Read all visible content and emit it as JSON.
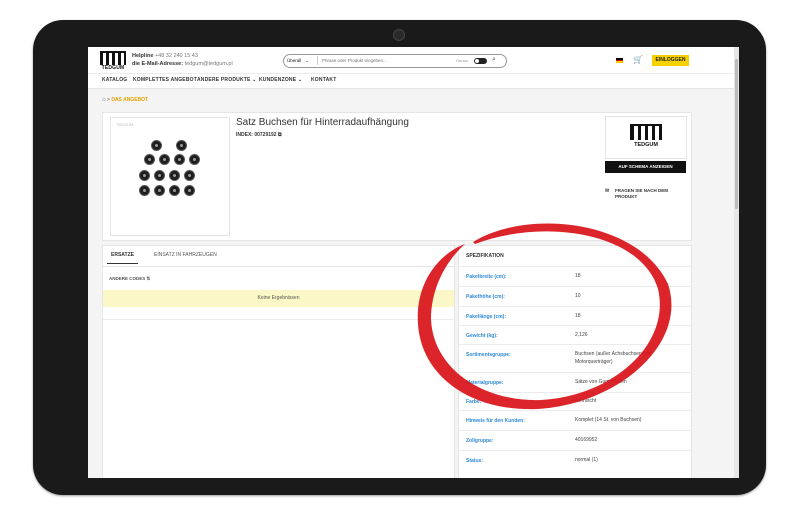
{
  "header": {
    "logo_text": "TEDGUM",
    "helpline_label": "Helpline",
    "helpline_number": "+48 32 240 15 43",
    "email_label": "die E-Mail-Adresse:",
    "email": "tedgum@tedgum.pl",
    "search_select": "Überall",
    "search_placeholder": "Phrase oder Produkt eingeben...",
    "toggle_label": "Genau",
    "login_label": "EINLOGGEN",
    "flag_colors": [
      "#000000",
      "#dd0000",
      "#ffce00"
    ]
  },
  "nav": {
    "items": [
      "KATALOG",
      "KOMPLETTES ANGEBOT",
      "ANDERE PRODUKTE ⌄",
      "KUNDENZONE ⌄",
      "KONTAKT"
    ]
  },
  "breadcrumb": {
    "separator": ">",
    "current": "DAS ANGEBOT"
  },
  "product": {
    "title": "Satz Buchsen für Hinterradaufhängung",
    "index_label": "INDEX:",
    "index_value": "00729192",
    "image_watermark": "TEDGUM",
    "brand_logo_text": "TEDGUM",
    "schema_button": "AUF SCHEMA ANZEIGEN",
    "ask_text": "FRAGEN SIE NACH DEM PRODUKT"
  },
  "left_panel": {
    "tabs": [
      "ERSATZE",
      "EINSATZ IN FAHRZEUGEN"
    ],
    "other_codes": "ANDERE CODES ⇅",
    "no_results": "Keine Ergebnissen"
  },
  "spec": {
    "title": "SPEZIFIKATION",
    "rows": [
      {
        "key": "Paketbreite (cm):",
        "value": "18"
      },
      {
        "key": "Pakethöhe (cm):",
        "value": "10"
      },
      {
        "key": "Paketlänge (cm):",
        "value": "18"
      },
      {
        "key": "Gewicht (kg):",
        "value": "2,126"
      },
      {
        "key": "Sortimentsgruppe:",
        "value": "Buchsen (außer Achsbuchsen und Motorquerträger)"
      },
      {
        "key": "Materialgruppe:",
        "value": "Sätze von Gummiteilen"
      },
      {
        "key": "Farbe:",
        "value": "Gemischt"
      },
      {
        "key": "Hinweis für den Kunden:",
        "value": "Komplet (14 St. von Buchsen)"
      },
      {
        "key": "Zollgruppe:",
        "value": "40169952"
      },
      {
        "key": "Status:",
        "value": "normal (1)"
      }
    ]
  },
  "colors": {
    "accent_yellow": "#f5d100",
    "link_blue": "#2f8ad6",
    "highlight_red": "#d9141b"
  }
}
